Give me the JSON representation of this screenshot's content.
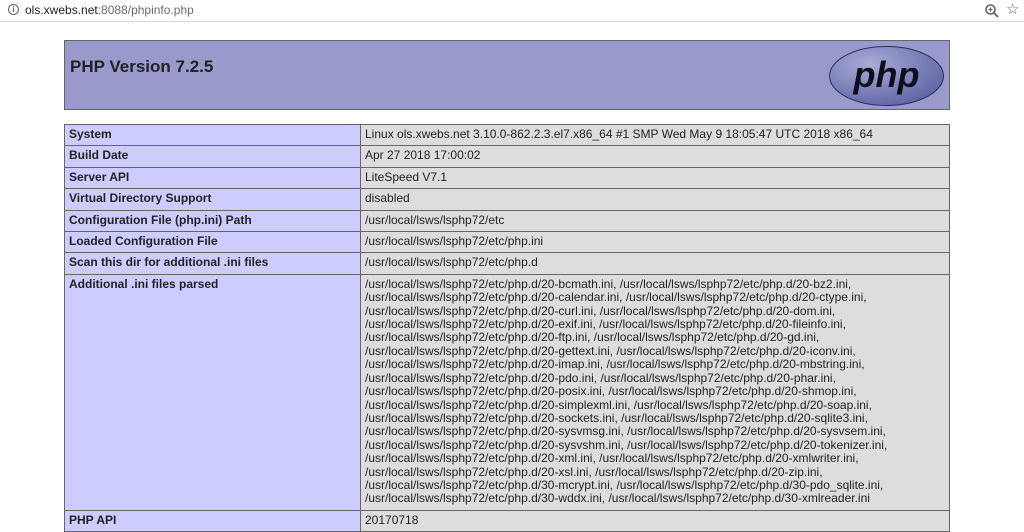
{
  "browser": {
    "url_host": "ols.xwebs.net",
    "url_path": ":8088/phpinfo.php"
  },
  "header": {
    "title": "PHP Version 7.2.5",
    "logo_text": "php"
  },
  "rows": [
    {
      "label": "System",
      "value": "Linux ols.xwebs.net 3.10.0-862.2.3.el7.x86_64 #1 SMP Wed May 9 18:05:47 UTC 2018 x86_64"
    },
    {
      "label": "Build Date",
      "value": "Apr 27 2018 17:00:02"
    },
    {
      "label": "Server API",
      "value": "LiteSpeed V7.1"
    },
    {
      "label": "Virtual Directory Support",
      "value": "disabled"
    },
    {
      "label": "Configuration File (php.ini) Path",
      "value": "/usr/local/lsws/lsphp72/etc"
    },
    {
      "label": "Loaded Configuration File",
      "value": "/usr/local/lsws/lsphp72/etc/php.ini"
    },
    {
      "label": "Scan this dir for additional .ini files",
      "value": "/usr/local/lsws/lsphp72/etc/php.d"
    }
  ],
  "additional_ini": {
    "label": "Additional .ini files parsed",
    "lines": [
      "/usr/local/lsws/lsphp72/etc/php.d/20-bcmath.ini, /usr/local/lsws/lsphp72/etc/php.d/20-bz2.ini,",
      "/usr/local/lsws/lsphp72/etc/php.d/20-calendar.ini, /usr/local/lsws/lsphp72/etc/php.d/20-ctype.ini,",
      "/usr/local/lsws/lsphp72/etc/php.d/20-curl.ini, /usr/local/lsws/lsphp72/etc/php.d/20-dom.ini,",
      "/usr/local/lsws/lsphp72/etc/php.d/20-exif.ini, /usr/local/lsws/lsphp72/etc/php.d/20-fileinfo.ini,",
      "/usr/local/lsws/lsphp72/etc/php.d/20-ftp.ini, /usr/local/lsws/lsphp72/etc/php.d/20-gd.ini,",
      "/usr/local/lsws/lsphp72/etc/php.d/20-gettext.ini, /usr/local/lsws/lsphp72/etc/php.d/20-iconv.ini,",
      "/usr/local/lsws/lsphp72/etc/php.d/20-imap.ini, /usr/local/lsws/lsphp72/etc/php.d/20-mbstring.ini,",
      "/usr/local/lsws/lsphp72/etc/php.d/20-pdo.ini, /usr/local/lsws/lsphp72/etc/php.d/20-phar.ini,",
      "/usr/local/lsws/lsphp72/etc/php.d/20-posix.ini, /usr/local/lsws/lsphp72/etc/php.d/20-shmop.ini,",
      "/usr/local/lsws/lsphp72/etc/php.d/20-simplexml.ini, /usr/local/lsws/lsphp72/etc/php.d/20-soap.ini,",
      "/usr/local/lsws/lsphp72/etc/php.d/20-sockets.ini, /usr/local/lsws/lsphp72/etc/php.d/20-sqlite3.ini,",
      "/usr/local/lsws/lsphp72/etc/php.d/20-sysvmsg.ini, /usr/local/lsws/lsphp72/etc/php.d/20-sysvsem.ini,",
      "/usr/local/lsws/lsphp72/etc/php.d/20-sysvshm.ini, /usr/local/lsws/lsphp72/etc/php.d/20-tokenizer.ini,",
      "/usr/local/lsws/lsphp72/etc/php.d/20-xml.ini, /usr/local/lsws/lsphp72/etc/php.d/20-xmlwriter.ini,",
      "/usr/local/lsws/lsphp72/etc/php.d/20-xsl.ini, /usr/local/lsws/lsphp72/etc/php.d/20-zip.ini,",
      "/usr/local/lsws/lsphp72/etc/php.d/30-mcrypt.ini, /usr/local/lsws/lsphp72/etc/php.d/30-pdo_sqlite.ini,",
      "/usr/local/lsws/lsphp72/etc/php.d/30-wddx.ini, /usr/local/lsws/lsphp72/etc/php.d/30-xmlreader.ini"
    ]
  },
  "cut_row": {
    "label": "PHP API",
    "value": "20170718"
  }
}
